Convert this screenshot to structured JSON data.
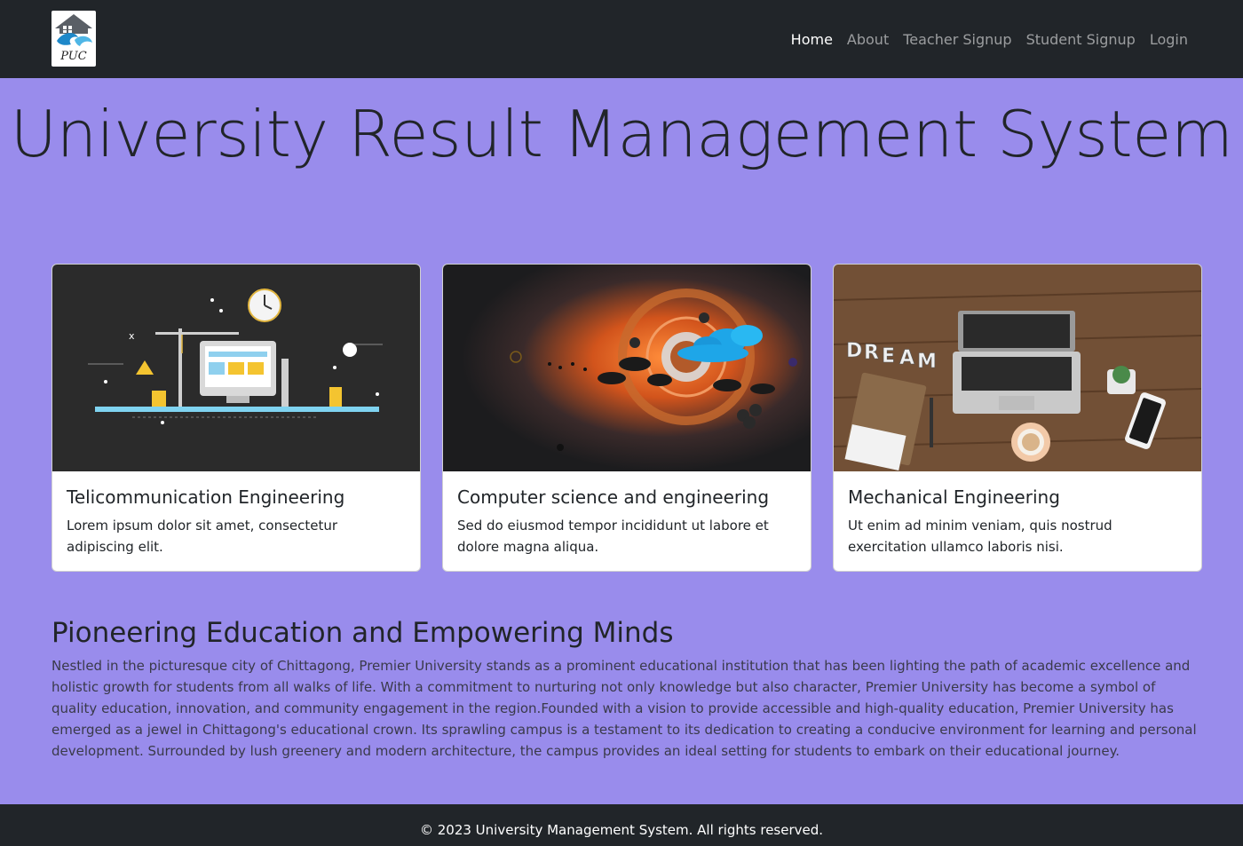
{
  "nav": {
    "logo_alt": "PUC",
    "links": [
      "Home",
      "About",
      "Teacher Signup",
      "Student Signup",
      "Login"
    ]
  },
  "hero": {
    "title": "University Result Management System"
  },
  "cards": [
    {
      "title": "Telicommunication Engineering",
      "text": "Lorem ipsum dolor sit amet, consectetur adipiscing elit."
    },
    {
      "title": "Computer science and engineering",
      "text": "Sed do eiusmod tempor incididunt ut labore et dolore magna aliqua."
    },
    {
      "title": "Mechanical Engineering",
      "text": "Ut enim ad minim veniam, quis nostrud exercitation ullamco laboris nisi."
    }
  ],
  "section": {
    "title": "Pioneering Education and Empowering Minds",
    "text": "Nestled in the picturesque city of Chittagong, Premier University stands as a prominent educational institution that has been lighting the path of academic excellence and holistic growth for students from all walks of life. With a commitment to nurturing not only knowledge but also character, Premier University has become a symbol of quality education, innovation, and community engagement in the region.Founded with a vision to provide accessible and high-quality education, Premier University has emerged as a jewel in Chittagong's educational crown. Its sprawling campus is a testament to its dedication to creating a conducive environment for learning and personal development. Surrounded by lush greenery and modern architecture, the campus provides an ideal setting for students to embark on their educational journey."
  },
  "footer": {
    "text": "© 2023 University Management System. All rights reserved."
  },
  "colors": {
    "page_bg": "#998cec",
    "navbar_bg": "#212529",
    "footer_bg": "#212529"
  }
}
